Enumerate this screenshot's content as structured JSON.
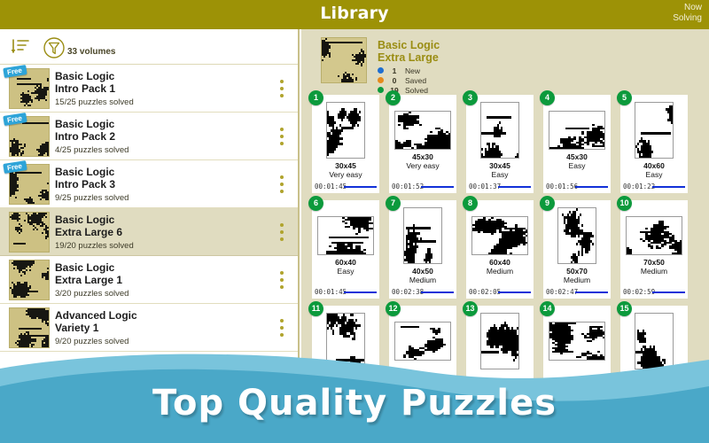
{
  "topbar": {
    "title": "Library",
    "now_solving_line1": "Now",
    "now_solving_line2": "Solving"
  },
  "sidebar": {
    "sort_icon": "sort-descending-icon",
    "filter_icon": "filter-funnel-icon",
    "volumes_count": "33 volumes",
    "items": [
      {
        "title_line1": "Basic Logic",
        "title_line2": "Intro Pack 1",
        "progress": "15/25 puzzles solved",
        "free": true,
        "badge_label": "Free",
        "selected": false
      },
      {
        "title_line1": "Basic Logic",
        "title_line2": "Intro Pack 2",
        "progress": "4/25 puzzles solved",
        "free": true,
        "badge_label": "Free",
        "selected": false
      },
      {
        "title_line1": "Basic Logic",
        "title_line2": "Intro Pack 3",
        "progress": "9/25 puzzles solved",
        "free": true,
        "badge_label": "Free",
        "selected": false
      },
      {
        "title_line1": "Basic Logic",
        "title_line2": "Extra Large 6",
        "progress": "19/20 puzzles solved",
        "free": false,
        "badge_label": "",
        "selected": true
      },
      {
        "title_line1": "Basic Logic",
        "title_line2": "Extra Large 1",
        "progress": "3/20 puzzles solved",
        "free": false,
        "badge_label": "",
        "selected": false
      },
      {
        "title_line1": "Advanced Logic",
        "title_line2": "Variety 1",
        "progress": "9/20 puzzles solved",
        "free": false,
        "badge_label": "",
        "selected": false
      }
    ]
  },
  "volume_header": {
    "title_line1": "Basic Logic",
    "title_line2": "Extra Large",
    "stats": [
      {
        "count": "1",
        "label": "New",
        "color": "#1f6fd0"
      },
      {
        "count": "0",
        "label": "Saved",
        "color": "#e58a1c"
      },
      {
        "count": "19",
        "label": "Solved",
        "color": "#0c9a3c"
      }
    ]
  },
  "puzzles": [
    {
      "number": "1",
      "size": "30x45",
      "difficulty": "Very easy",
      "time": "00:01:45",
      "orientation": "portrait"
    },
    {
      "number": "2",
      "size": "45x30",
      "difficulty": "Very easy",
      "time": "00:01:52",
      "orientation": "landscape"
    },
    {
      "number": "3",
      "size": "30x45",
      "difficulty": "Easy",
      "time": "00:01:37",
      "orientation": "portrait"
    },
    {
      "number": "4",
      "size": "45x30",
      "difficulty": "Easy",
      "time": "00:01:56",
      "orientation": "landscape"
    },
    {
      "number": "5",
      "size": "40x60",
      "difficulty": "Easy",
      "time": "00:01:22",
      "orientation": "portrait"
    },
    {
      "number": "6",
      "size": "60x40",
      "difficulty": "Easy",
      "time": "00:01:45",
      "orientation": "landscape"
    },
    {
      "number": "7",
      "size": "40x50",
      "difficulty": "Medium",
      "time": "00:02:38",
      "orientation": "portrait"
    },
    {
      "number": "8",
      "size": "60x40",
      "difficulty": "Medium",
      "time": "00:02:05",
      "orientation": "landscape"
    },
    {
      "number": "9",
      "size": "50x70",
      "difficulty": "Medium",
      "time": "00:02:47",
      "orientation": "portrait"
    },
    {
      "number": "10",
      "size": "70x50",
      "difficulty": "Medium",
      "time": "00:02:59",
      "orientation": "landscape"
    },
    {
      "number": "11",
      "size": "",
      "difficulty": "",
      "time": "",
      "orientation": "portrait"
    },
    {
      "number": "12",
      "size": "",
      "difficulty": "",
      "time": "",
      "orientation": "landscape"
    },
    {
      "number": "13",
      "size": "",
      "difficulty": "",
      "time": "",
      "orientation": "portrait"
    },
    {
      "number": "14",
      "size": "",
      "difficulty": "",
      "time": "",
      "orientation": "landscape"
    },
    {
      "number": "15",
      "size": "",
      "difficulty": "",
      "time": "",
      "orientation": "portrait"
    }
  ],
  "banner": {
    "text": "Top Quality Puzzles",
    "wave_color_front": "#4aa8c8",
    "wave_color_back": "#79c4dc"
  },
  "colors": {
    "topbar": "#9d9206",
    "panel_bg": "#e0dcc0",
    "accent_green": "#0c9a3c",
    "accent_blue": "#2ea4d8",
    "progress_bar": "#1231d8",
    "title_olive": "#9a8d13"
  }
}
